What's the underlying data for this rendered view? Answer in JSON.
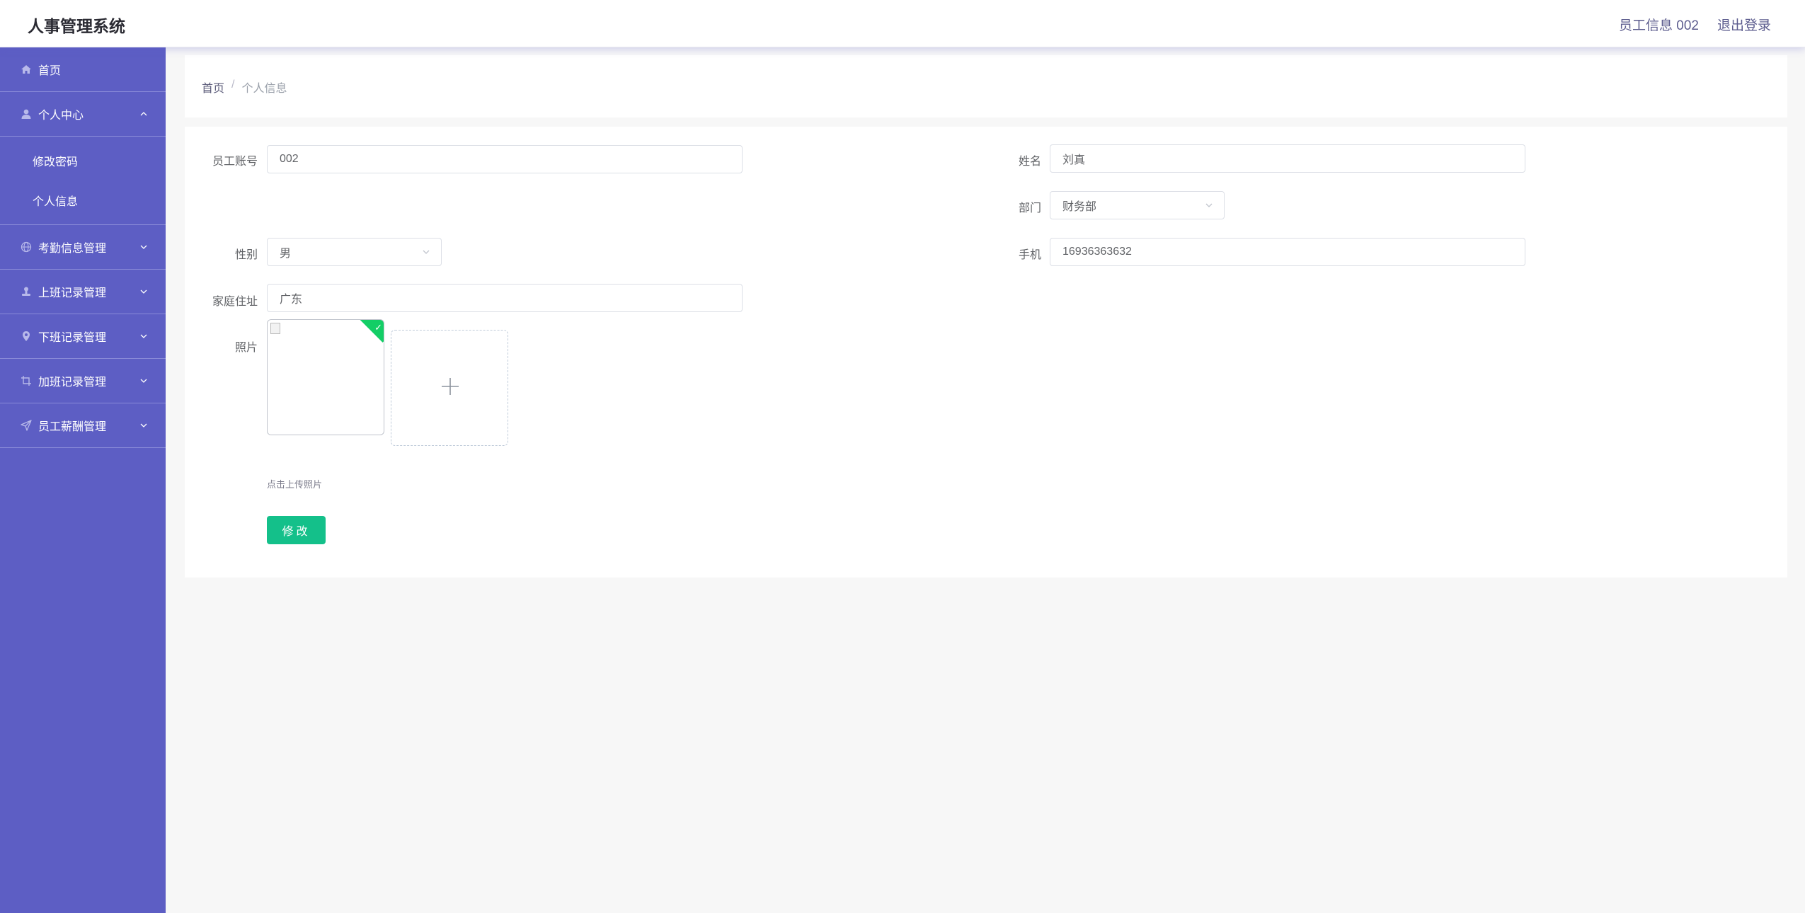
{
  "header": {
    "title": "人事管理系统",
    "user_info": "员工信息 002",
    "logout": "退出登录"
  },
  "sidebar": {
    "home": "首页",
    "personal_center": "个人中心",
    "sub_change_password": "修改密码",
    "sub_personal_info": "个人信息",
    "attendance": "考勤信息管理",
    "clock_in": "上班记录管理",
    "clock_out": "下班记录管理",
    "overtime": "加班记录管理",
    "salary": "员工薪酬管理"
  },
  "breadcrumb": {
    "home": "首页",
    "separator": "/",
    "current": "个人信息"
  },
  "form": {
    "account_label": "员工账号",
    "account_value": "002",
    "name_label": "姓名",
    "name_value": "刘真",
    "dept_label": "部门",
    "dept_value": "财务部",
    "gender_label": "性别",
    "gender_value": "男",
    "phone_label": "手机",
    "phone_value": "16936363632",
    "address_label": "家庭住址",
    "address_value": "广东",
    "photo_label": "照片",
    "upload_tip": "点击上传照片",
    "submit_label": "修改"
  },
  "colors": {
    "sidebar_bg": "#5d5ec4",
    "button_bg": "#14c08a",
    "success_corner": "#13ce66"
  }
}
